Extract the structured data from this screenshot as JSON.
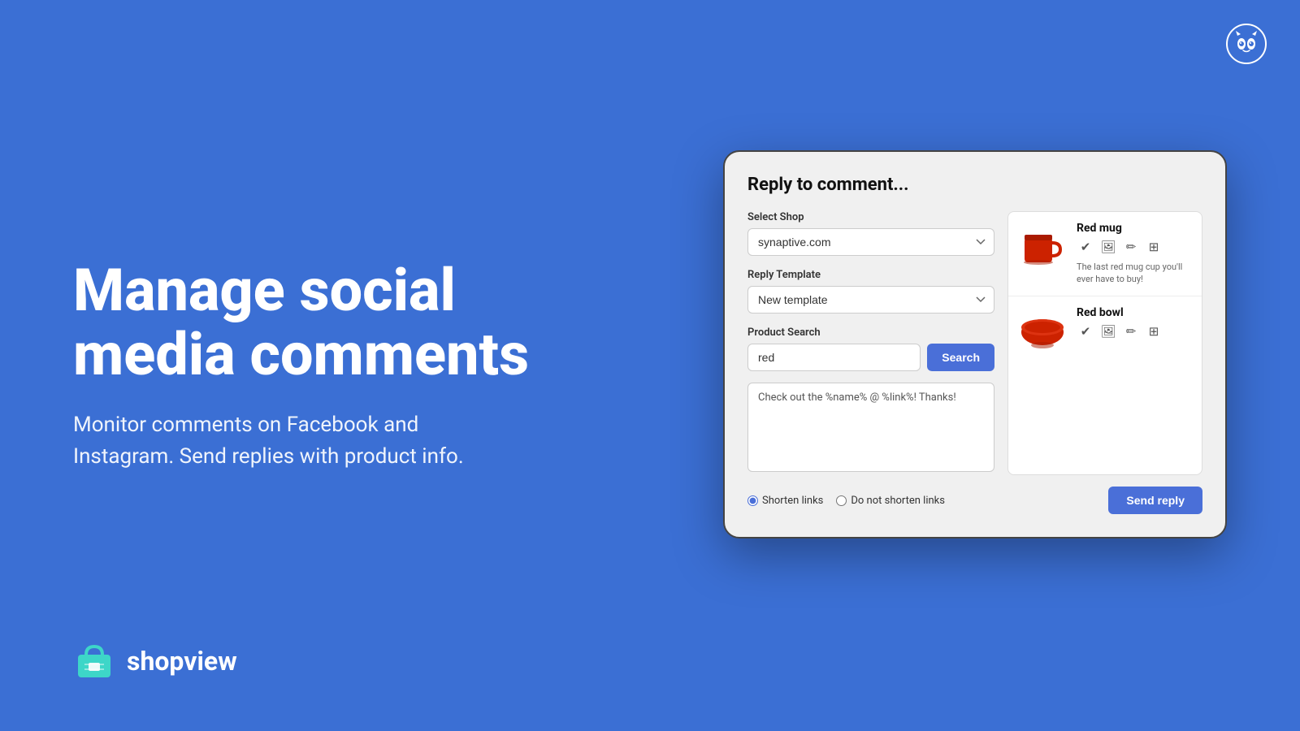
{
  "page": {
    "background_color": "#3b6fd4"
  },
  "owl_logo": {
    "aria": "Hootsuite owl logo"
  },
  "left": {
    "headline": "Manage social media comments",
    "subheadline": "Monitor comments on Facebook and Instagram. Send replies with product info.",
    "brand_name": "shopview"
  },
  "dialog": {
    "title": "Reply to comment...",
    "select_shop_label": "Select Shop",
    "select_shop_value": "synaptive.com",
    "reply_template_label": "Reply Template",
    "reply_template_value": "New template",
    "product_search_label": "Product Search",
    "search_input_value": "red",
    "search_button_label": "Search",
    "reply_text": "Check out the %name% @ %link%! Thanks!",
    "shorten_links_label": "Shorten links",
    "no_shorten_links_label": "Do not shorten links",
    "send_reply_label": "Send reply"
  },
  "products": [
    {
      "name": "Red mug",
      "description": "The last red mug cup you'll ever have to buy!",
      "color": "#cc2200"
    },
    {
      "name": "Red bowl",
      "description": "",
      "color": "#cc2200"
    }
  ]
}
